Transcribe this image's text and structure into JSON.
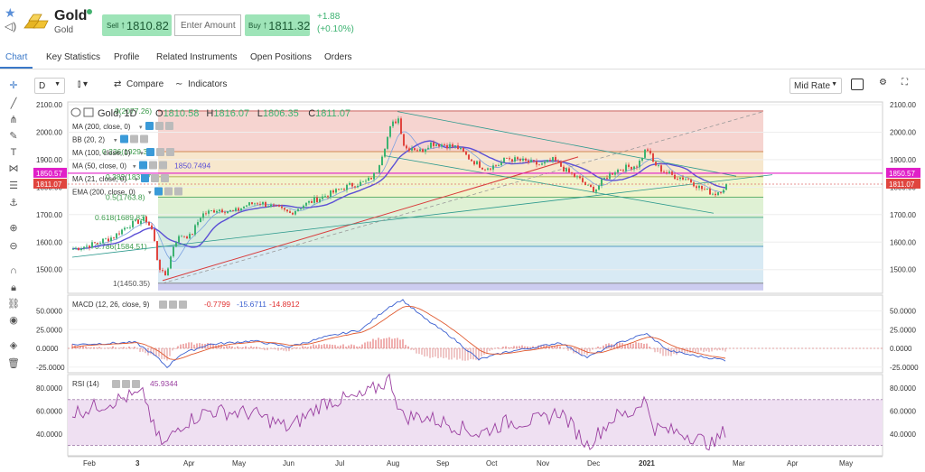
{
  "instrument": {
    "name": "Gold",
    "sub": "Gold",
    "sell_label": "Sell",
    "sell_price": "1810.82",
    "amount_placeholder": "Enter Amount",
    "buy_label": "Buy",
    "buy_price": "1811.32",
    "change_abs": "+1.88",
    "change_pct": "(+0.10%)"
  },
  "tabs": [
    "Chart",
    "Key Statistics",
    "Profile",
    "Related Instruments",
    "Open Positions",
    "Orders"
  ],
  "toolbar": {
    "interval": "D",
    "compare_label": "Compare",
    "indicators_label": "Indicators",
    "price_mode": "Mid Rate"
  },
  "legend": {
    "symbol": "Gold, 1D",
    "ohlc": [
      {
        "k": "O",
        "v": "1810.58"
      },
      {
        "k": "H",
        "v": "1816.07"
      },
      {
        "k": "L",
        "v": "1806.35"
      },
      {
        "k": "C",
        "v": "1811.07"
      }
    ],
    "studies": [
      {
        "label": "MA (200, close, 0)",
        "value": ""
      },
      {
        "label": "BB (20, 2)",
        "value": ""
      },
      {
        "label": "MA (100, close, 0)",
        "value": ""
      },
      {
        "label": "MA (50, close, 0)",
        "value": "1850.7494"
      },
      {
        "label": "MA (21, close, 0)",
        "value": ""
      },
      {
        "label": "EMA (200, close, 0)",
        "value": ""
      }
    ]
  },
  "fib_labels": [
    {
      "text": "0(2077.26)",
      "price": 2077.26
    },
    {
      "text": "0.236(1929.3)",
      "price": 1929.3
    },
    {
      "text": "0.382(1837.77)",
      "price": 1837.77
    },
    {
      "text": "0.5(1763.8)",
      "price": 1763.8
    },
    {
      "text": "0.618(1689.83)",
      "price": 1689.83
    },
    {
      "text": "0.786(1584.51)",
      "price": 1584.51
    },
    {
      "text": "1(1450.35)",
      "price": 1450.35
    }
  ],
  "price_axis": {
    "ticks": [
      "2100.00",
      "2000.00",
      "1900.00",
      "1800.00",
      "1700.00",
      "1600.00",
      "1500.00"
    ],
    "badges": {
      "ma50": "1850.57",
      "last": "1811.07"
    }
  },
  "time_axis": [
    "Feb",
    "3",
    "Apr",
    "May",
    "Jun",
    "Jul",
    "Aug",
    "Sep",
    "Oct",
    "Nov",
    "Dec",
    "2021",
    "Mar",
    "Apr",
    "May"
  ],
  "macd": {
    "label": "MACD (12, 26, close, 9)",
    "values": [
      "-0.7799",
      "-15.6711",
      "-14.8912"
    ],
    "ticks": [
      "50.0000",
      "25.0000",
      "0.0000",
      "-25.0000"
    ]
  },
  "rsi": {
    "label": "RSI (14)",
    "value": "45.9344",
    "ticks": [
      "80.0000",
      "60.0000",
      "40.0000"
    ]
  },
  "colors": {
    "up": "#3cb371",
    "down": "#e0453f",
    "ma50": "#5b4fd6",
    "ma200": "#d93b3b",
    "magenta": "#e020c8",
    "accent": "#3a78c8",
    "rsi": "#9a3fa0"
  }
}
